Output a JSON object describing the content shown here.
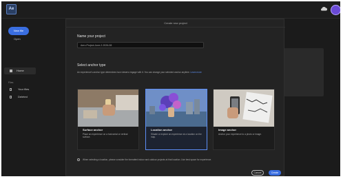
{
  "app": {
    "logo_text": "Ae"
  },
  "sidebar": {
    "new_file": "New file",
    "open": "Open",
    "home": "Home",
    "section": "Files",
    "items": [
      {
        "label": "Your files"
      },
      {
        "label": "Deleted"
      }
    ]
  },
  "modal": {
    "title": "Create new project",
    "name_label": "Name your project",
    "name_value": "Aero-Project-June-2-2026-08",
    "anchor_label": "Select anchor type",
    "anchor_desc": "An experience's anchor type determines how viewers engage with it. You can change your selected anchor anytime.",
    "learn_more": "Learn more",
    "cards": [
      {
        "title": "Surface anchor",
        "desc": "Place an experience on a horizontal or vertical surface."
      },
      {
        "title": "Location anchor",
        "desc": "Situate or explore an experience at a location on the map."
      },
      {
        "title": "Image anchor",
        "desc": "Anchor your experience to a photo or image."
      }
    ],
    "note": "When selecting a location, please consider the formatted indoor and outdoor projects at that location. Use best space for experience.",
    "cancel": "Cancel",
    "create": "Create"
  },
  "colors": {
    "accent": "#3a6ee0",
    "selected_border": "#5d8ff7"
  }
}
